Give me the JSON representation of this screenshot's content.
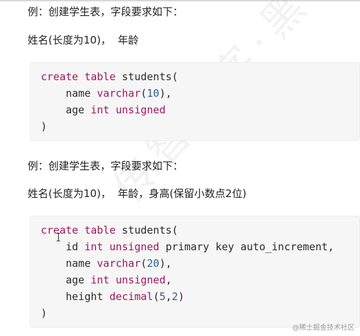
{
  "heading1": "例：创建学生表，字段要求如下：",
  "fields1": "姓名(长度为10)，  年龄",
  "code1": {
    "lines": [
      [
        [
          "kw",
          "create"
        ],
        [
          "t",
          " "
        ],
        [
          "kw",
          "table"
        ],
        [
          "t",
          " students("
        ]
      ],
      [
        [
          "t",
          "    name "
        ],
        [
          "kw",
          "varchar"
        ],
        [
          "t",
          "("
        ],
        [
          "num",
          "10"
        ],
        [
          "t",
          "),"
        ]
      ],
      [
        [
          "t",
          "    age "
        ],
        [
          "kw",
          "int"
        ],
        [
          "t",
          " "
        ],
        [
          "kw",
          "unsigned"
        ]
      ],
      [
        [
          "t",
          ")"
        ]
      ]
    ]
  },
  "heading2": "例：创建学生表，字段要求如下：",
  "fields2": "姓名(长度为10)，  年龄，身高(保留小数点2位)",
  "code2": {
    "lines": [
      [
        [
          "kw",
          "create"
        ],
        [
          "t",
          " "
        ],
        [
          "kw",
          "table"
        ],
        [
          "t",
          " students("
        ]
      ],
      [
        [
          "t",
          "    id "
        ],
        [
          "kw",
          "int"
        ],
        [
          "t",
          " "
        ],
        [
          "kw",
          "unsigned"
        ],
        [
          "t",
          " primary key auto_increment,"
        ]
      ],
      [
        [
          "t",
          "    name "
        ],
        [
          "kw",
          "varchar"
        ],
        [
          "t",
          "("
        ],
        [
          "num",
          "20"
        ],
        [
          "t",
          "),"
        ]
      ],
      [
        [
          "t",
          "    age "
        ],
        [
          "kw",
          "int"
        ],
        [
          "t",
          " "
        ],
        [
          "kw",
          "unsigned"
        ],
        [
          "t",
          ","
        ]
      ],
      [
        [
          "t",
          "    height "
        ],
        [
          "kw",
          "decimal"
        ],
        [
          "t",
          "("
        ],
        [
          "num",
          "5"
        ],
        [
          "t",
          ","
        ],
        [
          "num",
          "2"
        ],
        [
          "t",
          ")"
        ]
      ],
      [
        [
          "t",
          ")"
        ]
      ]
    ]
  },
  "watermark_text": "@稀土掘金技术社区",
  "background_watermark": "传智播客·黑马"
}
